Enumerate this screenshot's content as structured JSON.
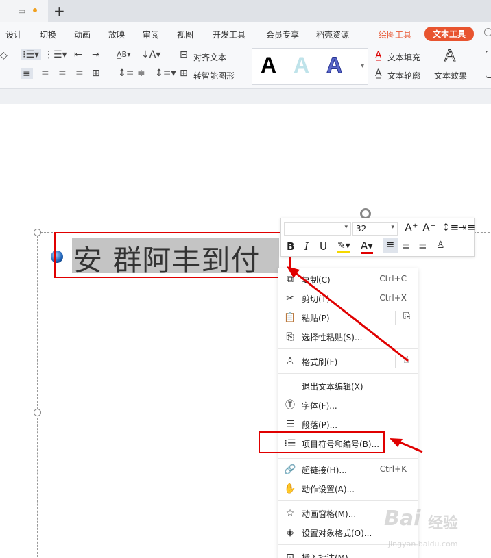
{
  "tabbar": {
    "new_tab": "+"
  },
  "menu": [
    "设计",
    "切换",
    "动画",
    "放映",
    "审阅",
    "视图",
    "开发工具",
    "会员专享",
    "稻壳资源",
    "绘图工具",
    "文本工具"
  ],
  "ribbon": {
    "align_text": "对齐文本",
    "smartart": "转智能图形",
    "fill": "文本填充",
    "outline": "文本轮廓",
    "effect": "文本效果",
    "style_letters": [
      "A",
      "A",
      "A"
    ]
  },
  "slide": {
    "text": "安 群阿丰到付"
  },
  "mini": {
    "font_size": "32"
  },
  "context_menu": [
    {
      "label": "复制(C)",
      "shortcut": "Ctrl+C"
    },
    {
      "label": "剪切(T)",
      "shortcut": "Ctrl+X"
    },
    {
      "label": "粘贴(P)",
      "shortcut": ""
    },
    {
      "label": "选择性粘贴(S)...",
      "shortcut": ""
    },
    {
      "label": "格式刷(F)",
      "shortcut": ""
    },
    {
      "label": "退出文本编辑(X)",
      "shortcut": ""
    },
    {
      "label": "字体(F)...",
      "shortcut": ""
    },
    {
      "label": "段落(P)...",
      "shortcut": ""
    },
    {
      "label": "项目符号和编号(B)...",
      "shortcut": ""
    },
    {
      "label": "超链接(H)...",
      "shortcut": "Ctrl+K"
    },
    {
      "label": "动作设置(A)...",
      "shortcut": ""
    },
    {
      "label": "动画窗格(M)...",
      "shortcut": ""
    },
    {
      "label": "设置对象格式(O)...",
      "shortcut": ""
    },
    {
      "label": "插入批注(M)",
      "shortcut": ""
    }
  ],
  "watermark": {
    "brand": "Bai",
    "brand2": "经验",
    "url": "jingyan.baidu.com"
  },
  "colors": {
    "accent": "#e8542f",
    "highlight": "#e00000"
  }
}
